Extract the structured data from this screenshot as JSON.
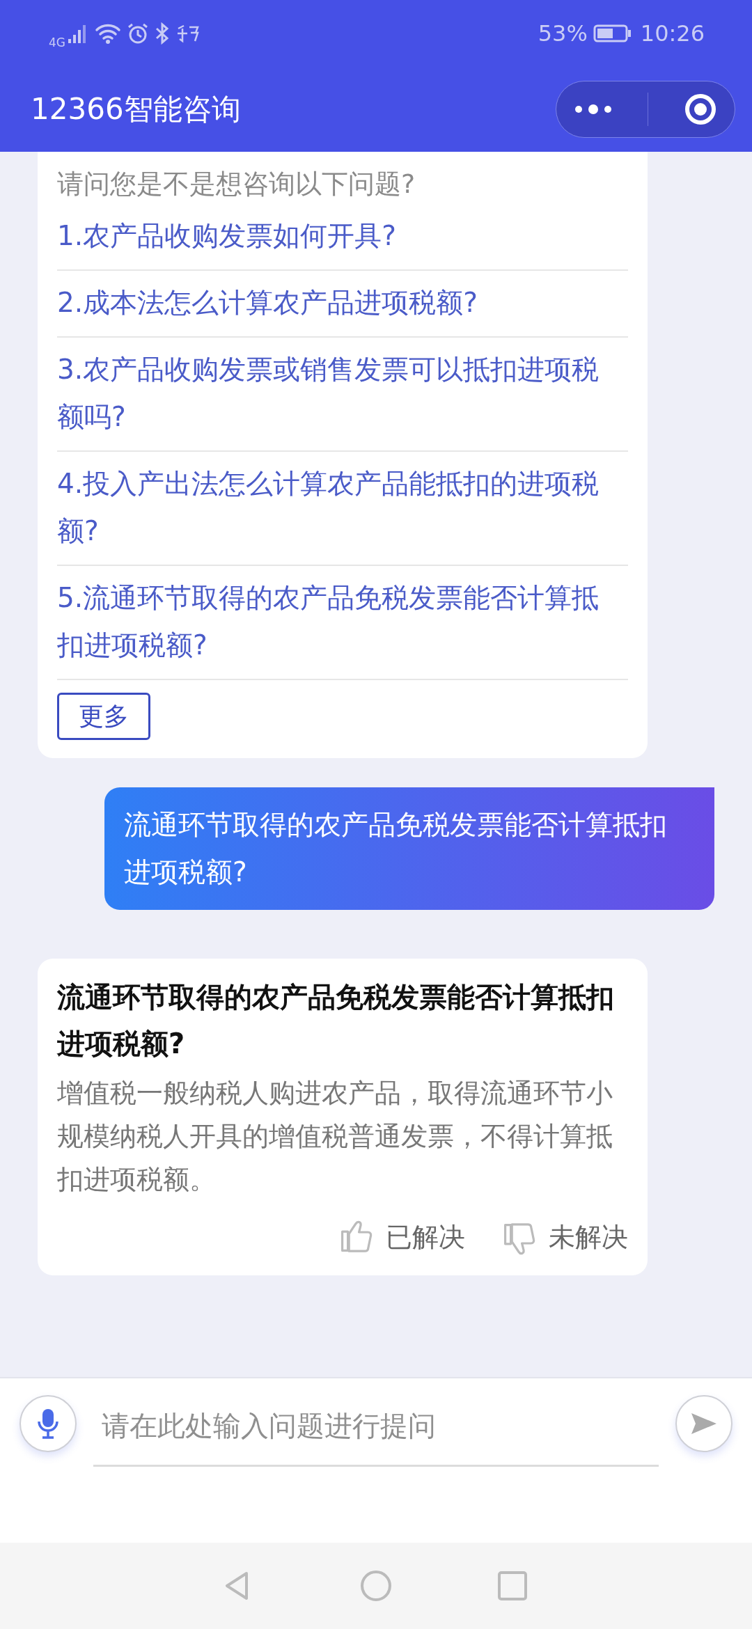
{
  "status_bar": {
    "network": "4G",
    "battery_percent": "53%",
    "time": "10:26"
  },
  "header": {
    "title": "12366智能咨询"
  },
  "suggestions": {
    "prompt": "请问您是不是想咨询以下问题?",
    "questions": [
      "1.农产品收购发票如何开具?",
      "2.成本法怎么计算农产品进项税额?",
      "3.农产品收购发票或销售发票可以抵扣进项税额吗?",
      "4.投入产出法怎么计算农产品能抵扣的进项税额?",
      "5.流通环节取得的农产品免税发票能否计算抵扣进项税额?"
    ],
    "more_button": "更多"
  },
  "messages": [
    {
      "kind": "user",
      "text": "流通环节取得的农产品免税发票能否计算抵扣进项税额?"
    },
    {
      "kind": "answer",
      "title": "流通环节取得的农产品免税发票能否计算抵扣进项税额?",
      "body": "增值税一般纳税人购进农产品，取得流通环节小规模纳税人开具的增值税普通发票，不得计算抵扣进项税额。",
      "feedback": [
        {
          "kind": "up",
          "label": "已解决"
        },
        {
          "kind": "down",
          "label": "未解决"
        }
      ]
    }
  ],
  "input": {
    "placeholder": "请在此处输入问题进行提问"
  }
}
